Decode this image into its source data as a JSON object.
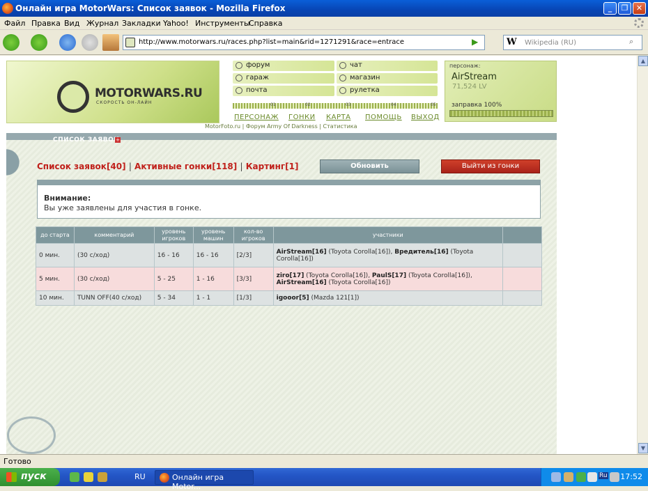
{
  "window": {
    "title": "Онлайн игра MotorWars: Список заявок - Mozilla Firefox"
  },
  "menu": [
    "Файл",
    "Правка",
    "Вид",
    "Журнал",
    "Закладки",
    "Yahoo!",
    "Инструменты",
    "Справка"
  ],
  "nav": {
    "url": "http://www.motorwars.ru/races.php?list=main&rid=1271291&race=entrace",
    "search_placeholder": "Wikipedia (RU)",
    "search_engine": "W"
  },
  "site": {
    "logo": "MOTORWARS.RU",
    "logo_sub": "СКОРОСТЬ ОН-ЛАЙН",
    "menu_left": [
      "форум",
      "гараж",
      "почта"
    ],
    "menu_right": [
      "чат",
      "магазин",
      "рулетка"
    ],
    "ruler_nums": [
      "01",
      "02",
      "03",
      "04",
      "05"
    ],
    "links": [
      "ПЕРСОНАЖ",
      "ГОНКИ",
      "КАРТА",
      "ПОМОЩЬ",
      "ВЫХОД"
    ],
    "sublinks": "MotorFoto.ru | Форум Army Of Darkness | Статистика",
    "character": {
      "header": "персонаж:",
      "name": "AirStream",
      "level": "71,524 LV",
      "fuel": "заправка 100%",
      "fuel_fraction": 1.0
    }
  },
  "panel": {
    "title": "СПИСОК ЗАЯВОК",
    "tabs": {
      "t1": "Список заявок[40]",
      "t2": "Активные гонки[118]",
      "t3": "Картинг[1]",
      "sep": "|"
    },
    "refresh": "Обновить",
    "leave": "Выйти из гонки",
    "alert_title": "Внимание:",
    "alert_text": "Вы уже заявлены для участия в гонке.",
    "headers": [
      "до старта",
      "комментарий",
      "уровень игроков",
      "уровень машин",
      "кол-во игроков",
      "участники"
    ],
    "rows": [
      {
        "start": "0 мин.",
        "comment": "(30 с/ход)",
        "plevel": "16 - 16",
        "clevel": "16 - 16",
        "count": "[2/3]",
        "p": [
          {
            "n": "AirStream[16]",
            "c": " (Toyota Corolla[16]), "
          },
          {
            "n": "Вредитель[16]",
            "c": " (Toyota Corolla[16])"
          }
        ]
      },
      {
        "start": "5 мин.",
        "comment": "(30 с/ход)",
        "plevel": "5 - 25",
        "clevel": "1 - 16",
        "count": "[3/3]",
        "p": [
          {
            "n": "ziro[17]",
            "c": " (Toyota Corolla[16]), "
          },
          {
            "n": "PaulS[17]",
            "c": " (Toyota Corolla[16]), "
          },
          {
            "n": "AirStream[16]",
            "c": " (Toyota Corolla[16])"
          }
        ]
      },
      {
        "start": "10 мин.",
        "comment": "TUNN OFF(40 с/ход)",
        "plevel": "5 - 34",
        "clevel": "1 - 1",
        "count": "[1/3]",
        "p": [
          {
            "n": "igooor[5]",
            "c": " (Mazda 121[1])"
          }
        ]
      }
    ]
  },
  "status": "Готово",
  "taskbar": {
    "start": "пуск",
    "lang": "RU",
    "task": "Онлайн игра Motor...",
    "clock": "17:52",
    "tray_lang": "Ru"
  }
}
